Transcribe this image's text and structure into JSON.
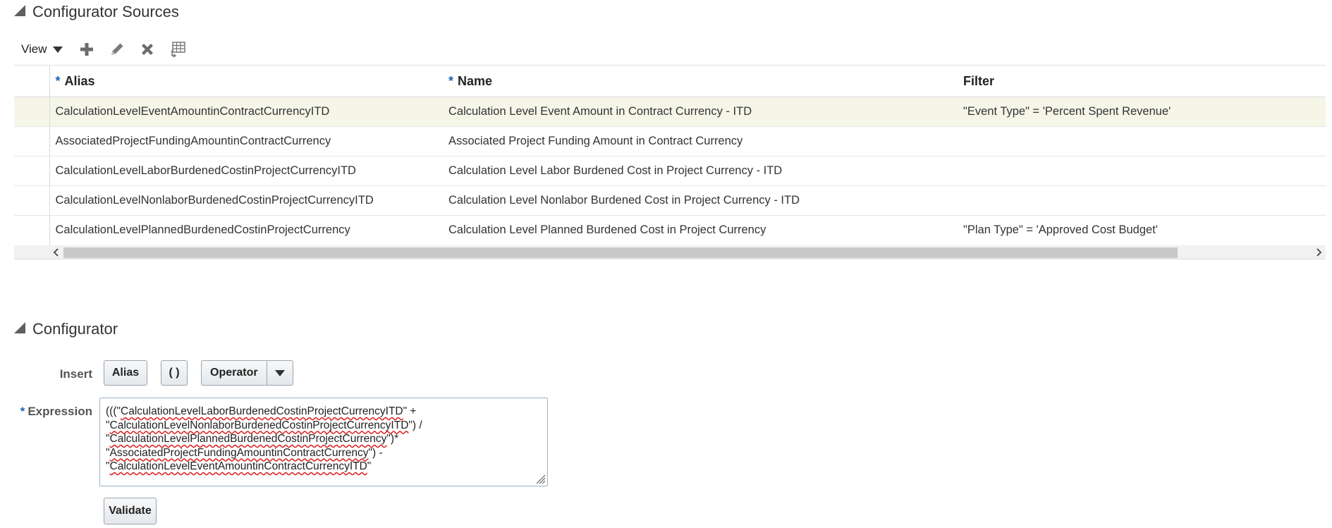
{
  "sources_section": {
    "title": "Configurator Sources",
    "toolbar": {
      "view_label": "View",
      "icons": [
        "add-icon",
        "edit-icon",
        "delete-icon",
        "freeze-columns-icon"
      ]
    },
    "table": {
      "columns": [
        {
          "label": "Alias",
          "required": true
        },
        {
          "label": "Name",
          "required": true
        },
        {
          "label": "Filter",
          "required": false
        }
      ],
      "required_marker": "*",
      "rows": [
        {
          "alias": "CalculationLevelEventAmountinContractCurrencyITD",
          "name": "Calculation Level Event Amount in Contract Currency - ITD",
          "filter": "\"Event Type\" = 'Percent Spent Revenue'",
          "selected": true
        },
        {
          "alias": "AssociatedProjectFundingAmountinContractCurrency",
          "name": "Associated Project Funding Amount in Contract Currency",
          "filter": "",
          "selected": false
        },
        {
          "alias": "CalculationLevelLaborBurdenedCostinProjectCurrencyITD",
          "name": "Calculation Level Labor Burdened Cost in Project Currency - ITD",
          "filter": "",
          "selected": false
        },
        {
          "alias": "CalculationLevelNonlaborBurdenedCostinProjectCurrencyITD",
          "name": "Calculation Level Nonlabor Burdened Cost in Project Currency - ITD",
          "filter": "",
          "selected": false
        },
        {
          "alias": "CalculationLevelPlannedBurdenedCostinProjectCurrency",
          "name": "Calculation Level Planned Burdened Cost in Project Currency",
          "filter": "\"Plan Type\" = 'Approved Cost Budget'",
          "selected": false
        }
      ]
    }
  },
  "configurator_section": {
    "title": "Configurator",
    "insert_label": "Insert",
    "alias_button": "Alias",
    "paren_button": "( )",
    "operator_button": "Operator",
    "expression_label": "Expression",
    "required_marker": "*",
    "expression_lines": [
      {
        "prefix": "(((\"",
        "token": "CalculationLevelLaborBurdenedCostinProjectCurrencyITD",
        "suffix": "\" +"
      },
      {
        "prefix": "\"",
        "token": "CalculationLevelNonlaborBurdenedCostinProjectCurrencyITD",
        "suffix": "\") /"
      },
      {
        "prefix": "\"",
        "token": "CalculationLevelPlannedBurdenedCostinProjectCurrency",
        "suffix": "\")*"
      },
      {
        "prefix": "\"",
        "token": "AssociatedProjectFundingAmountinContractCurrency",
        "suffix": "\") -"
      },
      {
        "prefix": "\"",
        "token": "CalculationLevelEventAmountinContractCurrencyITD",
        "suffix": "\""
      }
    ],
    "validate_button": "Validate"
  },
  "colors": {
    "selected_row": "#f6f6e8",
    "required_marker": "#1a66b3",
    "spellcheck_underline": "#dd2222"
  }
}
